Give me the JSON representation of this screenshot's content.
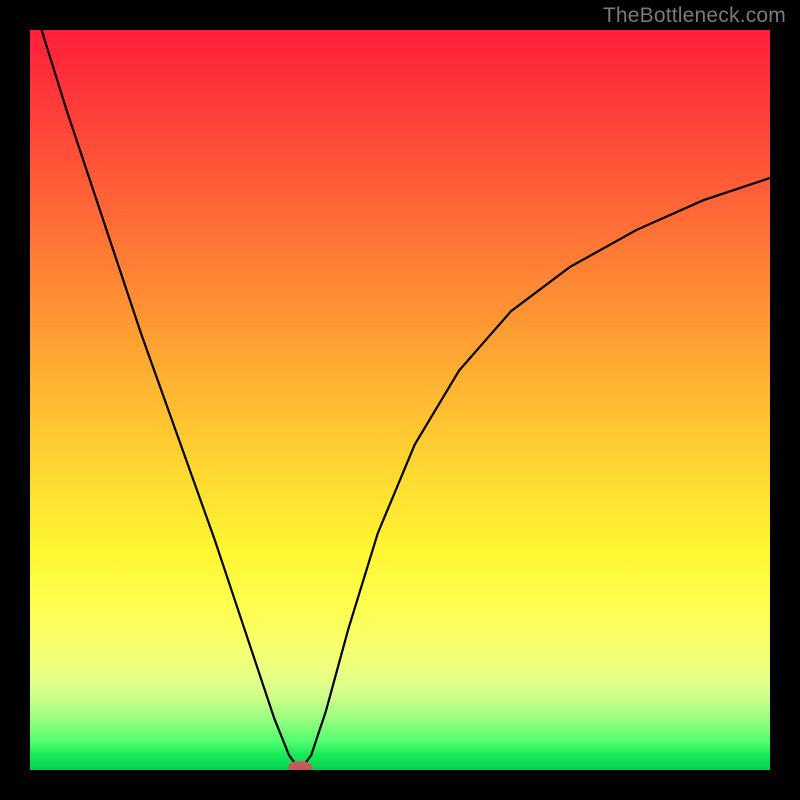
{
  "watermark": "TheBottleneck.com",
  "chart_data": {
    "type": "line",
    "title": "",
    "xlabel": "",
    "ylabel": "",
    "xlim": [
      0,
      1
    ],
    "ylim": [
      0,
      1
    ],
    "grid": false,
    "gradient_background": {
      "direction": "vertical",
      "stops": [
        {
          "pos": 0.0,
          "color": "#ff1f3a"
        },
        {
          "pos": 0.5,
          "color": "#ffba32"
        },
        {
          "pos": 0.78,
          "color": "#feff50"
        },
        {
          "pos": 1.0,
          "color": "#04d04e"
        }
      ]
    },
    "series": [
      {
        "name": "fit-curve",
        "color": "#000000",
        "x": [
          0.0,
          0.05,
          0.1,
          0.15,
          0.2,
          0.25,
          0.28,
          0.31,
          0.33,
          0.35,
          0.365,
          0.38,
          0.4,
          0.43,
          0.47,
          0.52,
          0.58,
          0.65,
          0.73,
          0.82,
          0.91,
          1.0
        ],
        "y": [
          1.05,
          0.89,
          0.74,
          0.59,
          0.45,
          0.31,
          0.22,
          0.13,
          0.07,
          0.02,
          0.0,
          0.02,
          0.08,
          0.19,
          0.32,
          0.44,
          0.54,
          0.62,
          0.68,
          0.73,
          0.77,
          0.8
        ]
      }
    ],
    "annotations": [
      {
        "name": "minimum-marker",
        "type": "oval",
        "x": 0.365,
        "y": 0.0,
        "color": "#c65a5a"
      }
    ]
  }
}
